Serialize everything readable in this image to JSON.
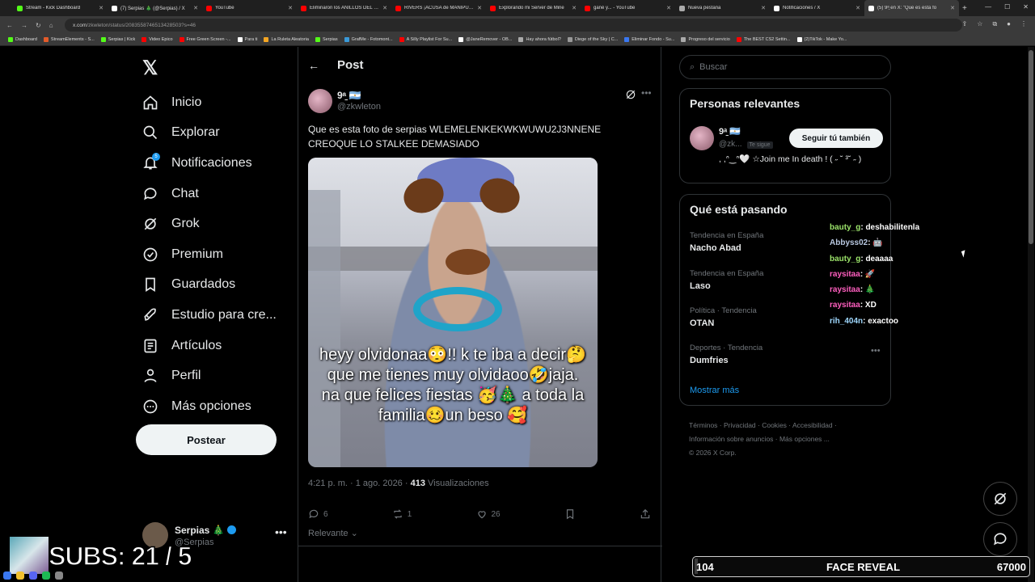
{
  "browser": {
    "tabs": [
      {
        "title": "Stream - Kick Dashboard",
        "color": "#53fc18"
      },
      {
        "title": "(7) Serpias 🎄 (@Serpias) / X",
        "color": "#ffffff"
      },
      {
        "title": "YouTube",
        "color": "#ff0000"
      },
      {
        "title": "Eliminaron los ANILLOS DEL DE",
        "color": "#ff0000"
      },
      {
        "title": "RIVERS ¡ACUSA de MANIPULA",
        "color": "#ff0000"
      },
      {
        "title": "Explorando mi Server de Mine",
        "color": "#ff0000"
      },
      {
        "title": "gané y... - YouTube",
        "color": "#ff0000"
      },
      {
        "title": "Nueva pestaña",
        "color": "#aaaaaa"
      },
      {
        "title": "Notificaciones / X",
        "color": "#ffffff"
      },
      {
        "title": "(5) 9ᵃ̱ en X: \"Que es esta fo",
        "color": "#ffffff"
      }
    ],
    "url_host": "x.com",
    "url_path": "/zkwleton/status/2083558746513428503?s=46",
    "bookmarks": [
      "Dashboard",
      "StreamElements - S...",
      "Serpias | Kick",
      "Video Epico",
      "Free Green Screen -...",
      "Para ti",
      "La Ruleta Aleatoria",
      "Serpias",
      "GrafMe - Fotomont...",
      "A Silly Playlist For Su...",
      "@JaneRemover - OB...",
      "Hay ahora fútbol?",
      "Diege of the Sky | C...",
      "Eliminar Fondo - Su...",
      "Progreso del servicio",
      "The BEST CS2 Settin...",
      "(2)TikTok - Make Yo..."
    ]
  },
  "nav": {
    "logo": "𝕏",
    "items": [
      {
        "label": "Inicio",
        "icon": "home-icon"
      },
      {
        "label": "Explorar",
        "icon": "search-icon"
      },
      {
        "label": "Notificaciones",
        "icon": "bell-icon",
        "badge": "5"
      },
      {
        "label": "Chat",
        "icon": "chat-icon"
      },
      {
        "label": "Grok",
        "icon": "grok-icon"
      },
      {
        "label": "Premium",
        "icon": "premium-icon"
      },
      {
        "label": "Guardados",
        "icon": "bookmark-icon"
      },
      {
        "label": "Estudio para cre...",
        "icon": "rocket-icon"
      },
      {
        "label": "Artículos",
        "icon": "article-icon"
      },
      {
        "label": "Perfil",
        "icon": "person-icon"
      },
      {
        "label": "Más opciones",
        "icon": "more-circle-icon"
      }
    ],
    "post_button": "Postear",
    "account": {
      "name": "Serpias 🎄",
      "handle": "@Serpias",
      "more": "•••"
    }
  },
  "post": {
    "header_title": "Post",
    "author_name": "9ᵃ̱ 🇦🇷",
    "author_handle": "@zkwleton",
    "text": "Que es esta foto de serpias WLEMELENKEKWKWUWU2J3NNENE CREOQUE LO STALKEE DEMASIADO",
    "image_caption": "heyy olvidonaa😳!! k te iba a decir🤔 que me tienes muy olvidaoo🤣jaja. na que felices fiestas 🥳🎄 a toda la familia🥴un beso 🥰",
    "time": "4:21 p. m. · 1 ago. 2026 · ",
    "views_count": "413",
    "views_label": " Visualizaciones",
    "replies": "6",
    "reposts": "1",
    "likes": "26",
    "relevant": "Relevante"
  },
  "sidebar": {
    "search_placeholder": "Buscar",
    "people_title": "Personas relevantes",
    "person": {
      "name": "9ᵃ̱ 🇦🇷",
      "handle": "@zk...",
      "follows_you": "Te sigue",
      "follow_button": "Seguir tú también",
      "bio": ", ,ᐢ‿ᐢ🤍 ☆Join me In death !  ( ˶ ˘ ³˘ ˶ )"
    },
    "trends_title": "Qué está pasando",
    "trends": [
      {
        "context": "Tendencia en España",
        "name": "Nacho Abad"
      },
      {
        "context": "Tendencia en España",
        "name": "Laso"
      },
      {
        "context": "Política · Tendencia",
        "name": "OTAN"
      },
      {
        "context": "Deportes · Tendencia",
        "name": "Dumfries"
      }
    ],
    "show_more": "Mostrar más",
    "footer_line1": "Términos  ·  Privacidad  ·  Cookies  ·  Accesibilidad  ·",
    "footer_line2": "Información sobre anuncios  ·  Más opciones ...",
    "footer_line3": "© 2026 X Corp."
  },
  "stream_chat": [
    {
      "user": "bauty_g",
      "msg": ": deshabilitenla",
      "color": "#9be36a"
    },
    {
      "user": "Abbyss02",
      "msg": ": 🤖",
      "color": "#b8c7e0"
    },
    {
      "user": "bauty_g",
      "msg": ": deaaaa",
      "color": "#9be36a"
    },
    {
      "user": "raysitaa",
      "msg": ": 🚀",
      "color": "#ff5fbf"
    },
    {
      "user": "raysitaa",
      "msg": ": 🎄",
      "color": "#ff5fbf"
    },
    {
      "user": "raysitaa",
      "msg": ": XD",
      "color": "#ff5fbf"
    },
    {
      "user": "rih_404n",
      "msg": ": exactoo",
      "color": "#9fd8ff"
    }
  ],
  "overlay": {
    "subs_text": "SUBS: 21 / 5",
    "goal_left": "104",
    "goal_label": "FACE REVEAL",
    "goal_right": "67000",
    "goal_progress": 0.0016
  },
  "colors": {
    "accent": "#1d9bf0",
    "background": "#000000",
    "text": "#e7e9ea",
    "muted": "#71767b"
  }
}
